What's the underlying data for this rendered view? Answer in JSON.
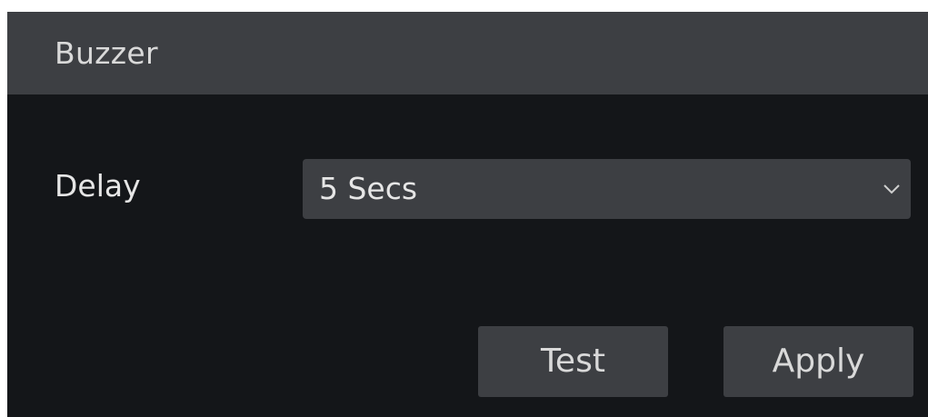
{
  "header": {
    "title": "Buzzer"
  },
  "form": {
    "delay_label": "Delay",
    "delay_value": "5 Secs"
  },
  "buttons": {
    "test": "Test",
    "apply": "Apply"
  },
  "icons": {
    "dropdown": "chevron-down-icon"
  },
  "colors": {
    "panel_bg": "#141619",
    "header_bg": "#3d3f43",
    "control_bg": "#3d3f43",
    "text": "#e6e6e6"
  }
}
